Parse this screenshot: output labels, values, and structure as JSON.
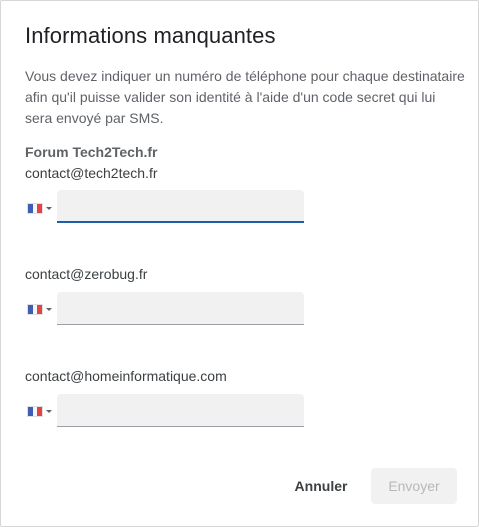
{
  "dialog": {
    "title": "Informations manquantes",
    "description": "Vous devez indiquer un numéro de téléphone pour chaque destinataire afin qu'il puisse valider son identité à l'aide d'un code secret qui lui sera envoyé par SMS."
  },
  "recipients": [
    {
      "name": "Forum Tech2Tech.fr",
      "email": "contact@tech2tech.fr",
      "country_flag": "france-flag-icon",
      "phone_value": "",
      "focused": true
    },
    {
      "name": "",
      "email": "contact@zerobug.fr",
      "country_flag": "france-flag-icon",
      "phone_value": "",
      "focused": false
    },
    {
      "name": "",
      "email": "contact@homeinformatique.com",
      "country_flag": "france-flag-icon",
      "phone_value": "",
      "focused": false
    }
  ],
  "actions": {
    "cancel_label": "Annuler",
    "send_label": "Envoyer"
  },
  "colors": {
    "focus_underline": "#1a5fa8",
    "input_background": "#f1f1f1",
    "disabled_text": "#b8b8b8"
  }
}
